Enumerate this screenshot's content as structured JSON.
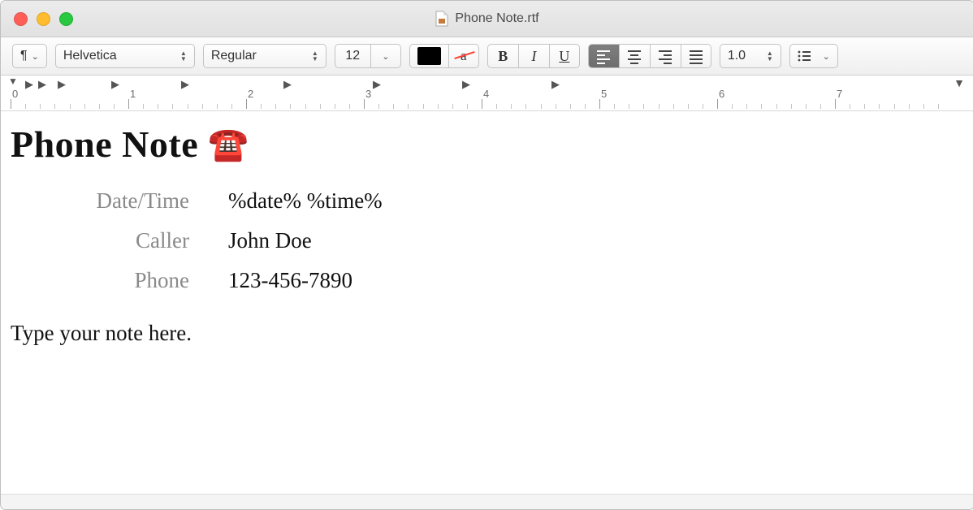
{
  "window": {
    "title": "Phone Note.rtf"
  },
  "toolbar": {
    "paragraph_symbol": "¶",
    "font_family": "Helvetica",
    "font_style": "Regular",
    "font_size": "12",
    "line_spacing": "1.0"
  },
  "ruler": {
    "labels": [
      "0",
      "1",
      "2",
      "3",
      "4",
      "5",
      "6",
      "7"
    ]
  },
  "document": {
    "title": "Phone Note",
    "emoji": "☎️",
    "fields": [
      {
        "label": "Date/Time",
        "value": "%date% %time%"
      },
      {
        "label": "Caller",
        "value": "John Doe"
      },
      {
        "label": "Phone",
        "value": "123-456-7890"
      }
    ],
    "body": "Type your note here."
  }
}
